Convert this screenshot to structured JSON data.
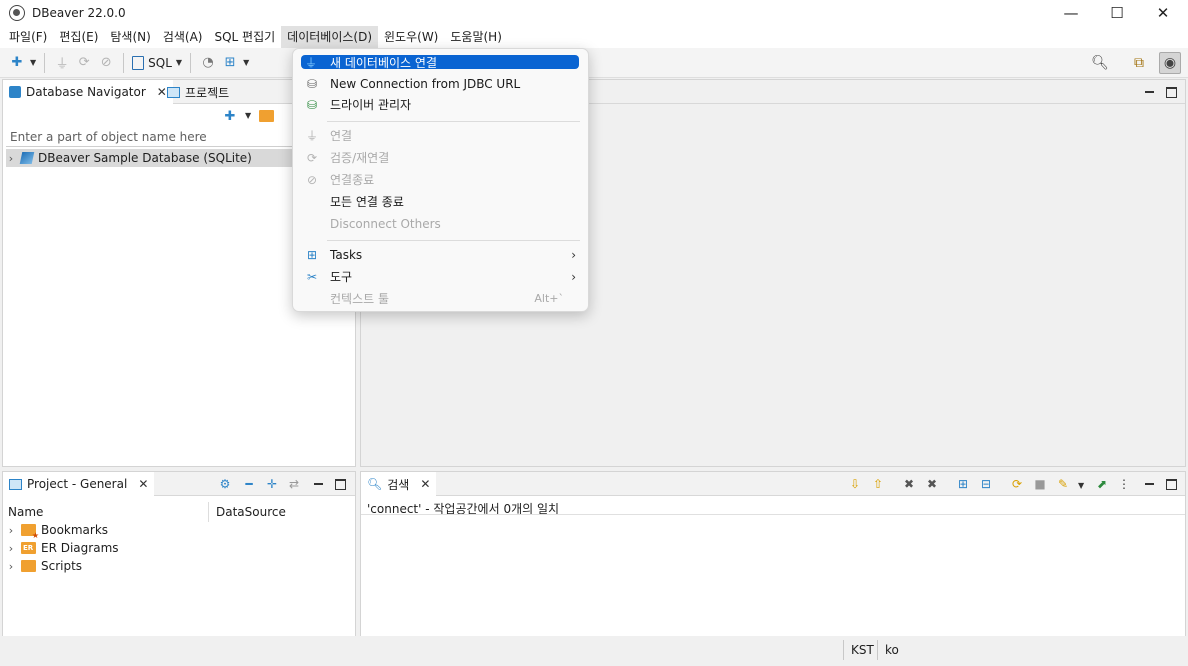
{
  "window": {
    "title": "DBeaver 22.0.0",
    "controls": {
      "minimize": "—",
      "maximize": "☐",
      "close": "✕"
    }
  },
  "menubar": {
    "items": [
      "파일(F)",
      "편집(E)",
      "탐색(N)",
      "검색(A)",
      "SQL 편집기",
      "데이터베이스(D)",
      "윈도우(W)",
      "도움말(H)"
    ],
    "open_index": 5
  },
  "toolbar": {
    "sql_label": "SQL"
  },
  "navigator": {
    "tabs": [
      {
        "label": "Database Navigator",
        "active": true
      },
      {
        "label": "프로젝트",
        "active": false
      }
    ],
    "filter_placeholder": "Enter a part of object name here",
    "tree": [
      {
        "label": "DBeaver Sample Database (SQLite)",
        "selected": true
      }
    ]
  },
  "project_panel": {
    "tab_label": "Project - General",
    "columns": [
      "Name",
      "DataSource"
    ],
    "items": [
      "Bookmarks",
      "ER Diagrams",
      "Scripts"
    ]
  },
  "search_panel": {
    "tab_label": "검색",
    "result_text": "'connect' - 작업공간에서 0개의 일치"
  },
  "statusbar": {
    "timezone": "KST",
    "locale": "ko"
  },
  "database_menu": {
    "items": [
      {
        "label": "새 데이터베이스 연결",
        "state": "highlighted",
        "icon": "plug-add-icon"
      },
      {
        "label": "New Connection from JDBC URL",
        "state": "enabled",
        "icon": "database-icon"
      },
      {
        "label": "드라이버 관리자",
        "state": "enabled",
        "icon": "driver-manager-icon"
      },
      {
        "label": "연결",
        "state": "disabled",
        "icon": "connect-icon"
      },
      {
        "label": "검증/재연결",
        "state": "disabled",
        "icon": "reconnect-icon"
      },
      {
        "label": "연결종료",
        "state": "disabled",
        "icon": "disconnect-icon"
      },
      {
        "label": "모든 연결 종료",
        "state": "enabled",
        "icon": ""
      },
      {
        "label": "Disconnect Others",
        "state": "disabled",
        "icon": ""
      },
      {
        "label": "Tasks",
        "state": "enabled",
        "icon": "tasks-icon",
        "submenu": true
      },
      {
        "label": "도구",
        "state": "enabled",
        "icon": "tools-icon",
        "submenu": true
      },
      {
        "label": "컨텍스트 툴",
        "state": "disabled",
        "icon": "",
        "shortcut": "Alt+`"
      }
    ]
  },
  "colors": {
    "highlight": "#0a64d2",
    "accent_blue": "#2d84c8",
    "disabled_text": "#a9a9a9",
    "folder_orange": "#f0a030"
  }
}
